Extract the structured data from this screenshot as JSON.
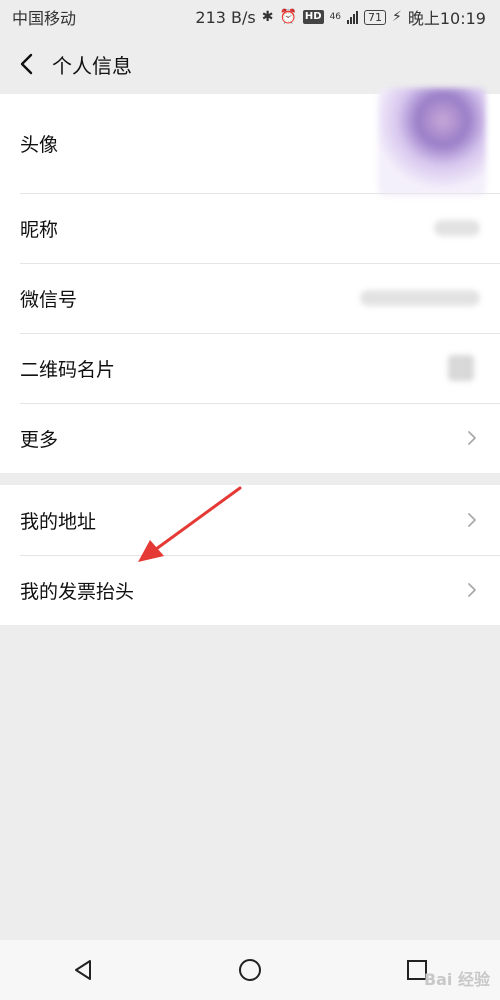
{
  "status": {
    "carrier": "中国移动",
    "speed": "213 B/s",
    "network": "46",
    "battery": "71",
    "time": "晚上10:19"
  },
  "header": {
    "title": "个人信息"
  },
  "rows": {
    "avatar": "头像",
    "nickname": "昵称",
    "wechat_id": "微信号",
    "qr_card": "二维码名片",
    "more": "更多",
    "address": "我的地址",
    "invoice": "我的发票抬头"
  },
  "watermark": "Bai 经验",
  "colors": {
    "annotation": "#e53935",
    "background": "#ededed"
  }
}
